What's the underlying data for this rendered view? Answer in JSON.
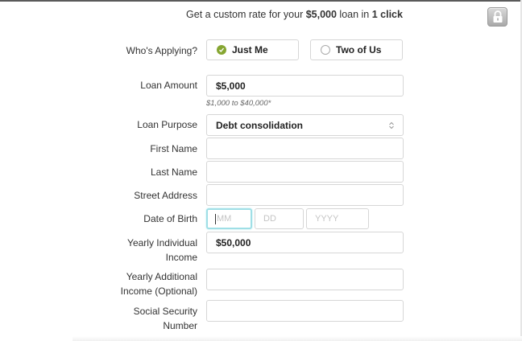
{
  "header": {
    "prefix": "Get a custom rate for your ",
    "amount": "$5,000",
    "middle": " loan in ",
    "click": "1 click",
    "lock_icon": "lock-icon"
  },
  "form": {
    "applying": {
      "label": "Who's Applying?",
      "options": [
        {
          "label": "Just Me",
          "selected": true
        },
        {
          "label": "Two of Us",
          "selected": false
        }
      ]
    },
    "loan_amount": {
      "label": "Loan Amount",
      "value": "$5,000",
      "hint": "$1,000 to $40,000*"
    },
    "loan_purpose": {
      "label": "Loan Purpose",
      "value": "Debt consolidation"
    },
    "first_name": {
      "label": "First Name",
      "value": ""
    },
    "last_name": {
      "label": "Last Name",
      "value": ""
    },
    "street_address": {
      "label": "Street Address",
      "value": ""
    },
    "dob": {
      "label": "Date of Birth",
      "mm": "MM",
      "dd": "DD",
      "yyyy": "YYYY"
    },
    "yearly_income": {
      "label_line1": "Yearly Individual",
      "label_line2": "Income",
      "value": "$50,000"
    },
    "additional_income": {
      "label_line1": "Yearly Additional",
      "label_line2": "Income (Optional)",
      "value": ""
    },
    "ssn": {
      "label_line1": "Social Security",
      "label_line2": "Number",
      "value": ""
    }
  },
  "colors": {
    "accent_green": "#86a632",
    "focus_ring": "#9fdfe6",
    "text": "#333333"
  }
}
